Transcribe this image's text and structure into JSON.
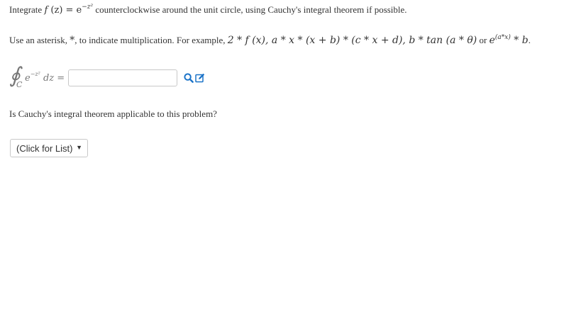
{
  "problem": {
    "lead": "Integrate ",
    "func_f": "f",
    "func_arg": " (z) = e",
    "func_exp": "−z²",
    "tail": " counterclockwise around the unit circle, using Cauchy's integral theorem if possible."
  },
  "instructions": {
    "lead": "Use an asterisk, ",
    "asterisk": "*",
    "mid": ", to indicate multiplication. For example, ",
    "ex1": "2 * f (x), a * x * (x + b) * (c * x + d), b * tan (a * θ)",
    "or_text": " or ",
    "ex2_base": "e",
    "ex2_exp": "(a*x)",
    "ex2_tail": " * b",
    "period": "."
  },
  "integral": {
    "contour": "C",
    "integrand_base": "e",
    "integrand_exp": "−z²",
    "differential": " dz =",
    "input_value": "",
    "input_placeholder": ""
  },
  "question": {
    "text": "Is Cauchy's integral theorem applicable to this problem?"
  },
  "dropdown": {
    "selected": "(Click for List)",
    "arrow": "▼"
  },
  "icons": {
    "preview": "magnifier-icon",
    "edit": "edit-pencil-icon",
    "accent": "#1a73c8"
  }
}
